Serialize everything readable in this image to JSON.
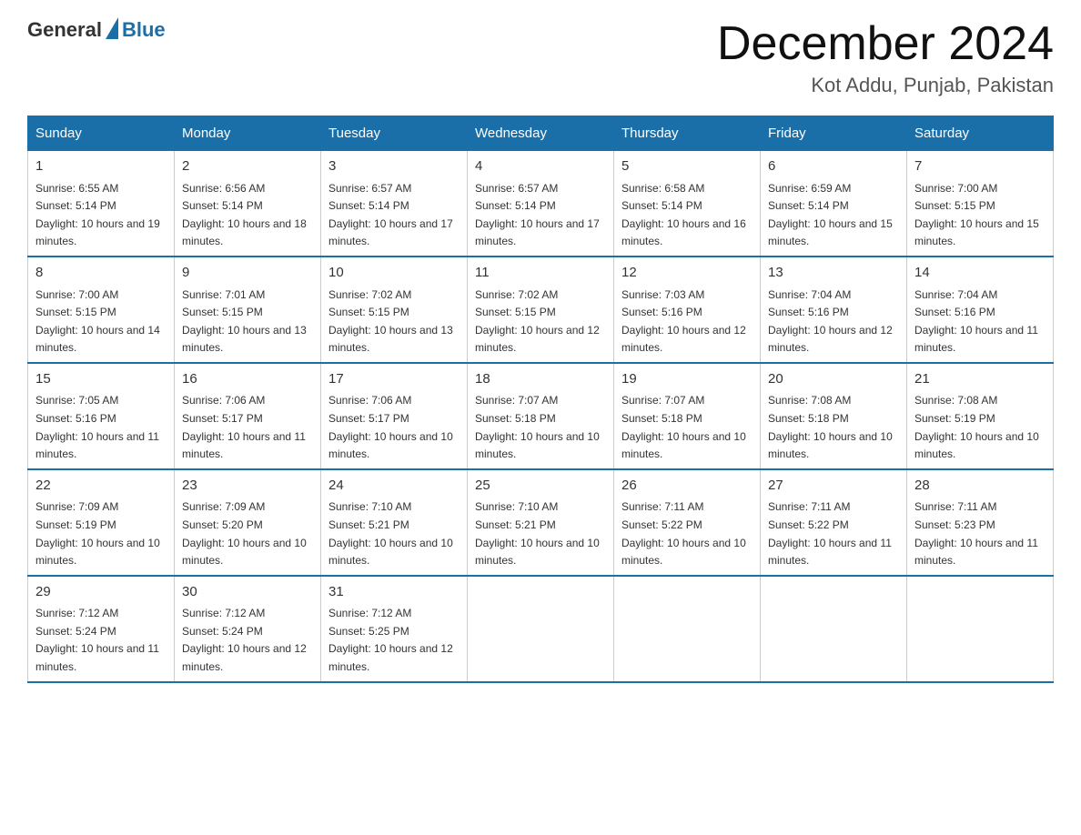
{
  "header": {
    "logo_general": "General",
    "logo_blue": "Blue",
    "title": "December 2024",
    "subtitle": "Kot Addu, Punjab, Pakistan"
  },
  "weekdays": [
    "Sunday",
    "Monday",
    "Tuesday",
    "Wednesday",
    "Thursday",
    "Friday",
    "Saturday"
  ],
  "weeks": [
    [
      {
        "day": "1",
        "sunrise": "6:55 AM",
        "sunset": "5:14 PM",
        "daylight": "10 hours and 19 minutes."
      },
      {
        "day": "2",
        "sunrise": "6:56 AM",
        "sunset": "5:14 PM",
        "daylight": "10 hours and 18 minutes."
      },
      {
        "day": "3",
        "sunrise": "6:57 AM",
        "sunset": "5:14 PM",
        "daylight": "10 hours and 17 minutes."
      },
      {
        "day": "4",
        "sunrise": "6:57 AM",
        "sunset": "5:14 PM",
        "daylight": "10 hours and 17 minutes."
      },
      {
        "day": "5",
        "sunrise": "6:58 AM",
        "sunset": "5:14 PM",
        "daylight": "10 hours and 16 minutes."
      },
      {
        "day": "6",
        "sunrise": "6:59 AM",
        "sunset": "5:14 PM",
        "daylight": "10 hours and 15 minutes."
      },
      {
        "day": "7",
        "sunrise": "7:00 AM",
        "sunset": "5:15 PM",
        "daylight": "10 hours and 15 minutes."
      }
    ],
    [
      {
        "day": "8",
        "sunrise": "7:00 AM",
        "sunset": "5:15 PM",
        "daylight": "10 hours and 14 minutes."
      },
      {
        "day": "9",
        "sunrise": "7:01 AM",
        "sunset": "5:15 PM",
        "daylight": "10 hours and 13 minutes."
      },
      {
        "day": "10",
        "sunrise": "7:02 AM",
        "sunset": "5:15 PM",
        "daylight": "10 hours and 13 minutes."
      },
      {
        "day": "11",
        "sunrise": "7:02 AM",
        "sunset": "5:15 PM",
        "daylight": "10 hours and 12 minutes."
      },
      {
        "day": "12",
        "sunrise": "7:03 AM",
        "sunset": "5:16 PM",
        "daylight": "10 hours and 12 minutes."
      },
      {
        "day": "13",
        "sunrise": "7:04 AM",
        "sunset": "5:16 PM",
        "daylight": "10 hours and 12 minutes."
      },
      {
        "day": "14",
        "sunrise": "7:04 AM",
        "sunset": "5:16 PM",
        "daylight": "10 hours and 11 minutes."
      }
    ],
    [
      {
        "day": "15",
        "sunrise": "7:05 AM",
        "sunset": "5:16 PM",
        "daylight": "10 hours and 11 minutes."
      },
      {
        "day": "16",
        "sunrise": "7:06 AM",
        "sunset": "5:17 PM",
        "daylight": "10 hours and 11 minutes."
      },
      {
        "day": "17",
        "sunrise": "7:06 AM",
        "sunset": "5:17 PM",
        "daylight": "10 hours and 10 minutes."
      },
      {
        "day": "18",
        "sunrise": "7:07 AM",
        "sunset": "5:18 PM",
        "daylight": "10 hours and 10 minutes."
      },
      {
        "day": "19",
        "sunrise": "7:07 AM",
        "sunset": "5:18 PM",
        "daylight": "10 hours and 10 minutes."
      },
      {
        "day": "20",
        "sunrise": "7:08 AM",
        "sunset": "5:18 PM",
        "daylight": "10 hours and 10 minutes."
      },
      {
        "day": "21",
        "sunrise": "7:08 AM",
        "sunset": "5:19 PM",
        "daylight": "10 hours and 10 minutes."
      }
    ],
    [
      {
        "day": "22",
        "sunrise": "7:09 AM",
        "sunset": "5:19 PM",
        "daylight": "10 hours and 10 minutes."
      },
      {
        "day": "23",
        "sunrise": "7:09 AM",
        "sunset": "5:20 PM",
        "daylight": "10 hours and 10 minutes."
      },
      {
        "day": "24",
        "sunrise": "7:10 AM",
        "sunset": "5:21 PM",
        "daylight": "10 hours and 10 minutes."
      },
      {
        "day": "25",
        "sunrise": "7:10 AM",
        "sunset": "5:21 PM",
        "daylight": "10 hours and 10 minutes."
      },
      {
        "day": "26",
        "sunrise": "7:11 AM",
        "sunset": "5:22 PM",
        "daylight": "10 hours and 10 minutes."
      },
      {
        "day": "27",
        "sunrise": "7:11 AM",
        "sunset": "5:22 PM",
        "daylight": "10 hours and 11 minutes."
      },
      {
        "day": "28",
        "sunrise": "7:11 AM",
        "sunset": "5:23 PM",
        "daylight": "10 hours and 11 minutes."
      }
    ],
    [
      {
        "day": "29",
        "sunrise": "7:12 AM",
        "sunset": "5:24 PM",
        "daylight": "10 hours and 11 minutes."
      },
      {
        "day": "30",
        "sunrise": "7:12 AM",
        "sunset": "5:24 PM",
        "daylight": "10 hours and 12 minutes."
      },
      {
        "day": "31",
        "sunrise": "7:12 AM",
        "sunset": "5:25 PM",
        "daylight": "10 hours and 12 minutes."
      },
      null,
      null,
      null,
      null
    ]
  ]
}
